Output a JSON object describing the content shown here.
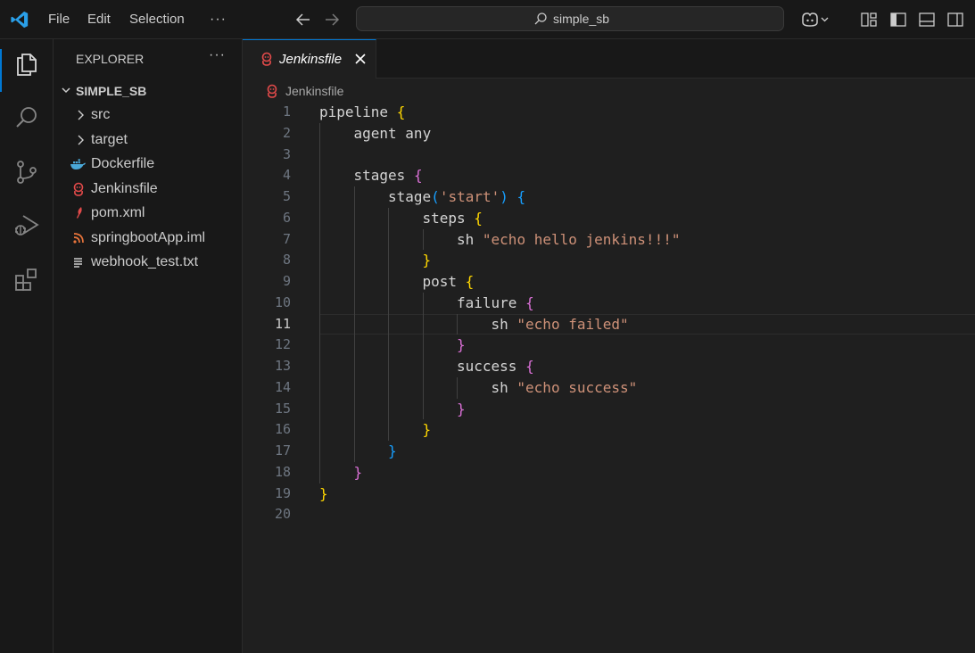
{
  "titlebar": {
    "menus": [
      "File",
      "Edit",
      "Selection",
      "···"
    ],
    "search_text": "simple_sb"
  },
  "explorer": {
    "title": "EXPLORER",
    "more": "···",
    "folder": "SIMPLE_SB",
    "items": [
      {
        "label": "src",
        "icon": "chevron-right-icon"
      },
      {
        "label": "target",
        "icon": "chevron-right-icon"
      },
      {
        "label": "Dockerfile",
        "icon": "docker-icon"
      },
      {
        "label": "Jenkinsfile",
        "icon": "jenkins-icon"
      },
      {
        "label": "pom.xml",
        "icon": "maven-feather-icon"
      },
      {
        "label": "springbootApp.iml",
        "icon": "rss-icon"
      },
      {
        "label": "webhook_test.txt",
        "icon": "text-file-icon"
      }
    ]
  },
  "editor": {
    "tab_label": "Jenkinsfile",
    "breadcrumb": "Jenkinsfile",
    "current_line": 11,
    "lines": [
      {
        "n": "1",
        "indent": 0,
        "parts": [
          [
            "k",
            "pipeline "
          ],
          [
            "b1",
            "{"
          ]
        ]
      },
      {
        "n": "2",
        "indent": 1,
        "parts": [
          [
            "k",
            "agent any"
          ]
        ]
      },
      {
        "n": "3",
        "indent": 0,
        "parts": []
      },
      {
        "n": "4",
        "indent": 1,
        "parts": [
          [
            "k",
            "stages "
          ],
          [
            "b2",
            "{"
          ]
        ]
      },
      {
        "n": "5",
        "indent": 2,
        "parts": [
          [
            "k",
            "stage"
          ],
          [
            "b3",
            "("
          ],
          [
            "s",
            "'start'"
          ],
          [
            "b3",
            ")"
          ],
          [
            "k",
            " "
          ],
          [
            "b3",
            "{"
          ]
        ]
      },
      {
        "n": "6",
        "indent": 3,
        "parts": [
          [
            "k",
            "steps "
          ],
          [
            "b1",
            "{"
          ]
        ]
      },
      {
        "n": "7",
        "indent": 4,
        "parts": [
          [
            "k",
            "sh "
          ],
          [
            "s",
            "\"echo hello jenkins!!!\""
          ]
        ]
      },
      {
        "n": "8",
        "indent": 3,
        "parts": [
          [
            "b1",
            "}"
          ]
        ]
      },
      {
        "n": "9",
        "indent": 3,
        "parts": [
          [
            "k",
            "post "
          ],
          [
            "b1",
            "{"
          ]
        ]
      },
      {
        "n": "10",
        "indent": 4,
        "parts": [
          [
            "k",
            "failure "
          ],
          [
            "b2",
            "{"
          ]
        ]
      },
      {
        "n": "11",
        "indent": 5,
        "parts": [
          [
            "k",
            "sh "
          ],
          [
            "s",
            "\"echo failed\""
          ]
        ]
      },
      {
        "n": "12",
        "indent": 4,
        "parts": [
          [
            "b2",
            "}"
          ]
        ]
      },
      {
        "n": "13",
        "indent": 4,
        "parts": [
          [
            "k",
            "success "
          ],
          [
            "b2",
            "{"
          ]
        ]
      },
      {
        "n": "14",
        "indent": 5,
        "parts": [
          [
            "k",
            "sh "
          ],
          [
            "s",
            "\"echo success\""
          ]
        ]
      },
      {
        "n": "15",
        "indent": 4,
        "parts": [
          [
            "b2",
            "}"
          ]
        ]
      },
      {
        "n": "16",
        "indent": 3,
        "parts": [
          [
            "b1",
            "}"
          ]
        ]
      },
      {
        "n": "17",
        "indent": 2,
        "parts": [
          [
            "b3",
            "}"
          ]
        ]
      },
      {
        "n": "18",
        "indent": 1,
        "parts": [
          [
            "b2",
            "}"
          ]
        ]
      },
      {
        "n": "19",
        "indent": 0,
        "parts": [
          [
            "b1",
            "}"
          ]
        ]
      },
      {
        "n": "20",
        "indent": 0,
        "parts": []
      }
    ]
  },
  "colors": {
    "accent": "#0078d4",
    "string": "#ce9178",
    "bracket_gold": "#ffd700",
    "bracket_orchid": "#da70d6",
    "bracket_blue": "#179fff",
    "jenkins_red": "#e24a4a",
    "docker_blue": "#4aa8d8"
  }
}
